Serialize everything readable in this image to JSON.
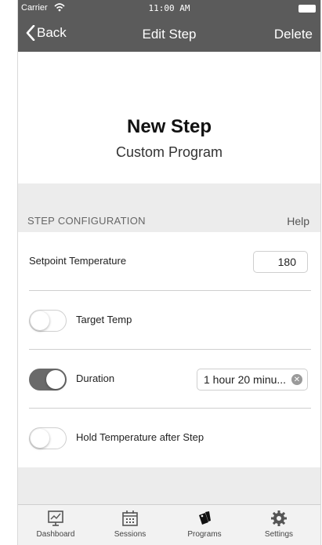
{
  "status_bar": {
    "carrier": "Carrier",
    "time": "11:00 AM"
  },
  "nav": {
    "back_label": "Back",
    "title": "Edit Step",
    "delete_label": "Delete"
  },
  "header": {
    "step_name": "New Step",
    "program_name": "Custom Program"
  },
  "section": {
    "title": "STEP CONFIGURATION",
    "help_label": "Help"
  },
  "rows": {
    "setpoint": {
      "label": "Setpoint Temperature",
      "value": "180"
    },
    "target_temp": {
      "label": "Target Temp",
      "enabled": false
    },
    "duration": {
      "label": "Duration",
      "enabled": true,
      "value": "1 hour 20 minu..."
    },
    "hold_temp": {
      "label": "Hold Temperature after Step",
      "enabled": false
    }
  },
  "tab_bar": {
    "tabs": [
      {
        "label": "Dashboard",
        "icon": "monitor-chart-icon"
      },
      {
        "label": "Sessions",
        "icon": "calendar-icon"
      },
      {
        "label": "Programs",
        "icon": "tags-icon"
      },
      {
        "label": "Settings",
        "icon": "gear-icon"
      }
    ]
  },
  "colors": {
    "nav_background": "#5b5b5b",
    "toggle_on": "#6a6a6a",
    "section_background": "#ececec"
  }
}
